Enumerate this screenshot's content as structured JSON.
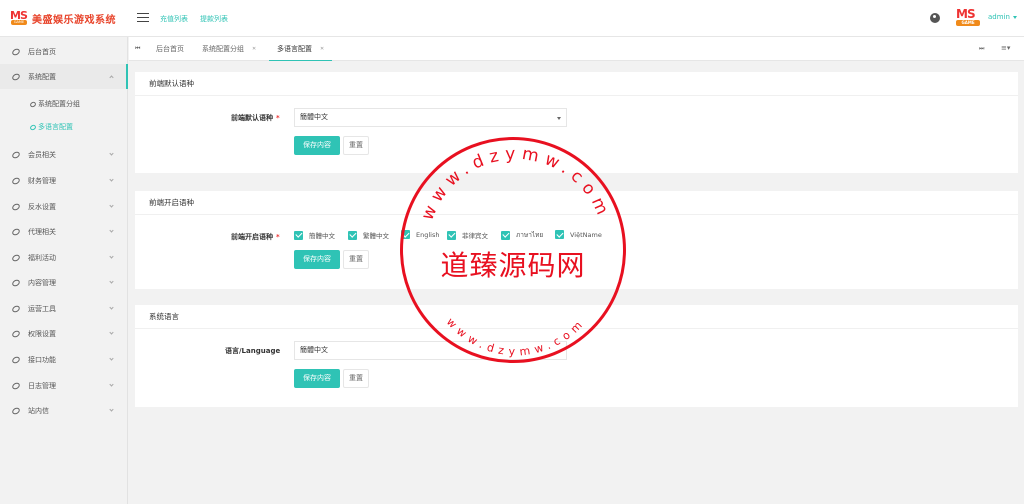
{
  "header": {
    "logo_text": "美盛娱乐游戏系统",
    "logo_mark": "MS",
    "logo_sub": "GAME",
    "links": [
      "充值列表",
      "提款列表"
    ],
    "user": "admin"
  },
  "sidebar": {
    "items": [
      {
        "label": "后台首页"
      },
      {
        "label": "系统配置"
      },
      {
        "label": "会员相关"
      },
      {
        "label": "财务管理"
      },
      {
        "label": "反水设置"
      },
      {
        "label": "代理相关"
      },
      {
        "label": "福利活动"
      },
      {
        "label": "内容管理"
      },
      {
        "label": "运营工具"
      },
      {
        "label": "权限设置"
      },
      {
        "label": "接口功能"
      },
      {
        "label": "日志管理"
      },
      {
        "label": "站内信"
      }
    ],
    "subitems": [
      {
        "label": "系统配置分组"
      },
      {
        "label": "多语言配置"
      }
    ]
  },
  "tabs": [
    {
      "label": "后台首页"
    },
    {
      "label": "系统配置分组"
    },
    {
      "label": "多语言配置"
    }
  ],
  "sections": {
    "default_lang": {
      "title": "前端默认语种",
      "label": "前端默认语种",
      "value": "簡體中文",
      "save": "保存内容",
      "reset": "重置"
    },
    "enabled_langs": {
      "title": "前端开启语种",
      "label": "前端开启语种",
      "options": [
        "簡體中文",
        "繁體中文",
        "English",
        "菲律宾文",
        "ภาษาไทย",
        "ViệtName"
      ],
      "save": "保存内容",
      "reset": "重置"
    },
    "system_lang": {
      "title": "系统语言",
      "label": "语言/Language",
      "value": "簡體中文",
      "save": "保存内容",
      "reset": "重置"
    }
  },
  "watermark": {
    "center": "道臻源码网",
    "top_arc": "www.dzymw.com",
    "bottom_arc": "www.dzymw.com"
  },
  "colors": {
    "accent": "#2fc3b5",
    "stamp": "#e81020",
    "logo": "#e8442b"
  }
}
